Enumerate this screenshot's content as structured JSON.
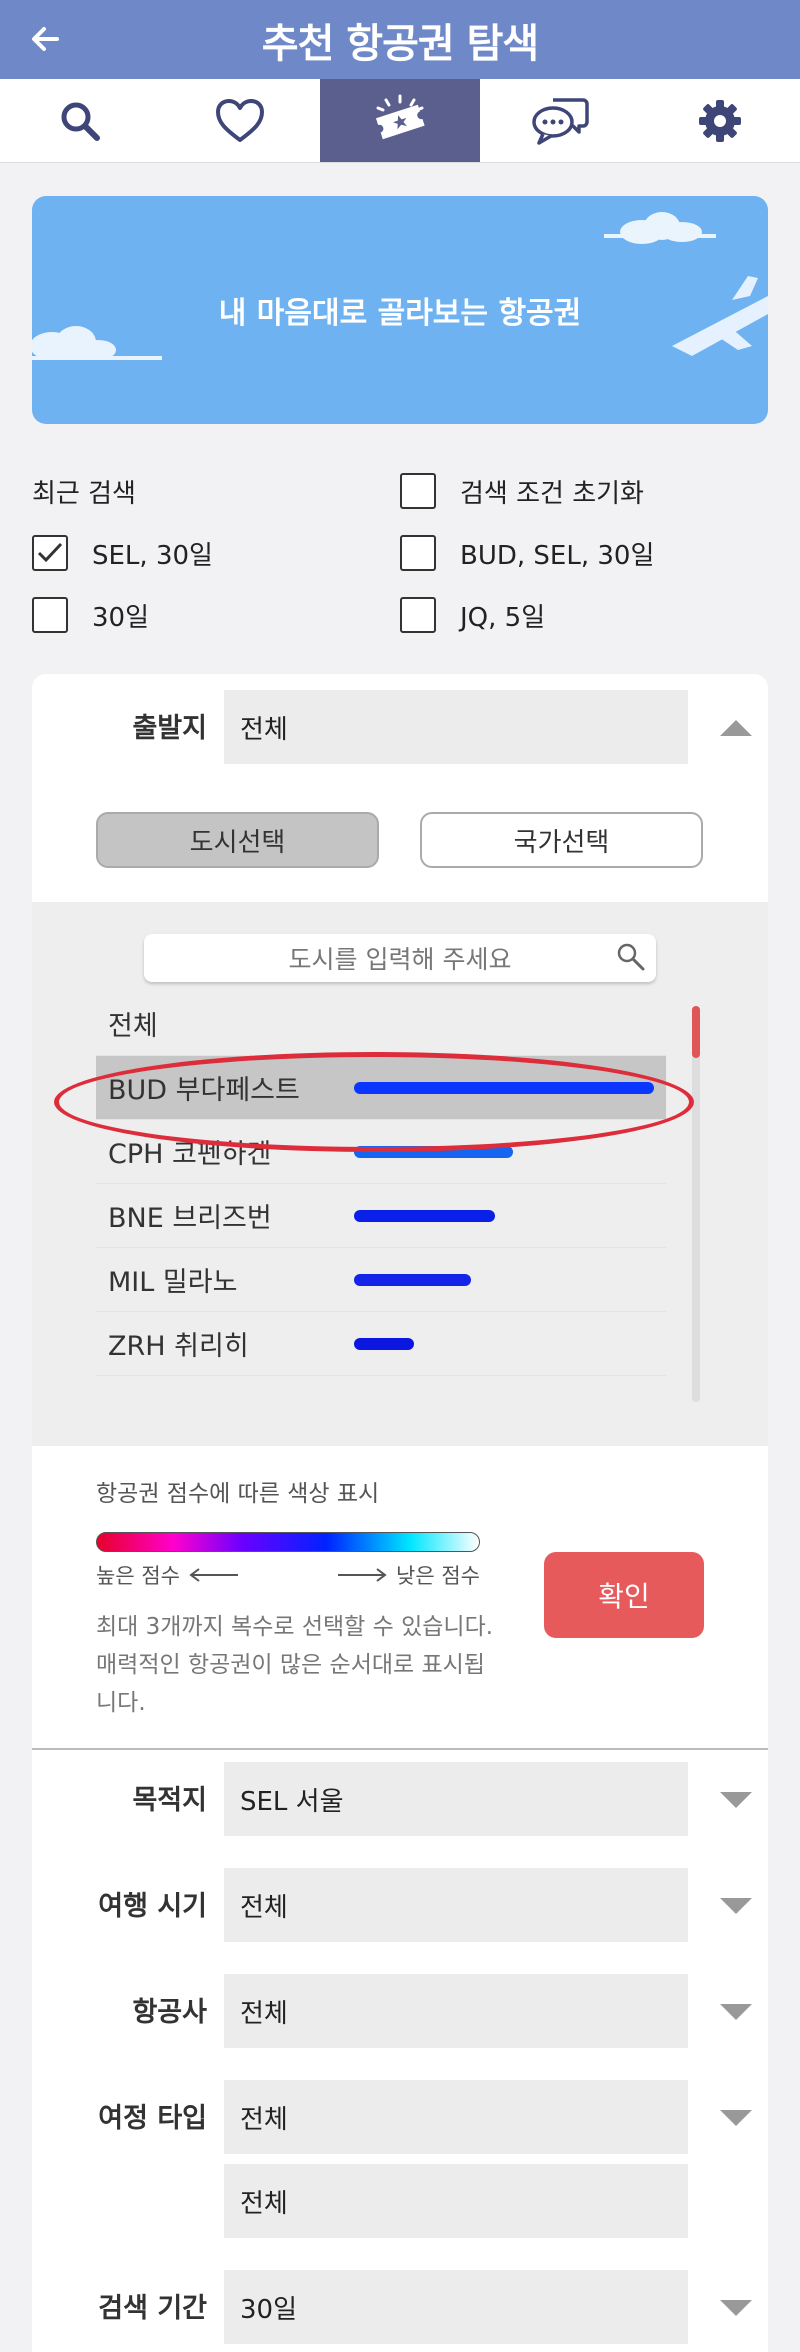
{
  "header": {
    "title": "추천 항공권 탐색",
    "back_icon": "arrow-left-icon"
  },
  "tabs": [
    {
      "icon": "search-icon",
      "active": false
    },
    {
      "icon": "heart-icon",
      "active": false
    },
    {
      "icon": "ticket-icon",
      "active": true
    },
    {
      "icon": "chat-icon",
      "active": false
    },
    {
      "icon": "gear-icon",
      "active": false
    }
  ],
  "banner": {
    "title": "내 마음대로 골라보는 항공권"
  },
  "recent": {
    "title": "최근 검색",
    "reset_label": "검색 조건 초기화",
    "items": [
      {
        "label": "SEL, 30일",
        "checked": true
      },
      {
        "label": "BUD, SEL, 30일",
        "checked": false
      },
      {
        "label": "30일",
        "checked": false
      },
      {
        "label": "JQ, 5일",
        "checked": false
      }
    ]
  },
  "origin": {
    "label": "출발지",
    "value": "전체",
    "city_tab": "도시선택",
    "country_tab": "국가선택",
    "search_placeholder": "도시를 입력해 주세요",
    "cities": [
      {
        "label": "전체",
        "score": null,
        "color": ""
      },
      {
        "label": "BUD 부다페스트",
        "score": 1.0,
        "color": "#0a36ff",
        "selected": true
      },
      {
        "label": "CPH 코펜하겐",
        "score": 0.53,
        "color": "#1565f0"
      },
      {
        "label": "BNE 브리즈번",
        "score": 0.47,
        "color": "#0a1fe8"
      },
      {
        "label": "MIL 밀라노",
        "score": 0.39,
        "color": "#1424e8"
      },
      {
        "label": "ZRH 취리히",
        "score": 0.2,
        "color": "#0b16e0"
      }
    ],
    "legend_title": "항공권 점수에 따른 색상 표시",
    "legend_high": "높은 점수",
    "legend_low": "낮은 점수",
    "note": "최대 3개까지 복수로 선택할 수 있습니다. 매력적인 항공권이 많은 순서대로 표시됩니다.",
    "confirm_label": "확인"
  },
  "filters": [
    {
      "label": "목적지",
      "value": "SEL 서울"
    },
    {
      "label": "여행 시기",
      "value": "전체"
    },
    {
      "label": "항공사",
      "value": "전체"
    },
    {
      "label": "여정 타입",
      "value": "전체",
      "value2": "전체"
    },
    {
      "label": "검색 기간",
      "value": "30일"
    }
  ],
  "colors": {
    "appbar": "#6f88c8",
    "active_tab": "#5a5f8e",
    "banner": "#6fb2f2",
    "confirm": "#e75a5c",
    "highlight": "#dd2d3a"
  }
}
